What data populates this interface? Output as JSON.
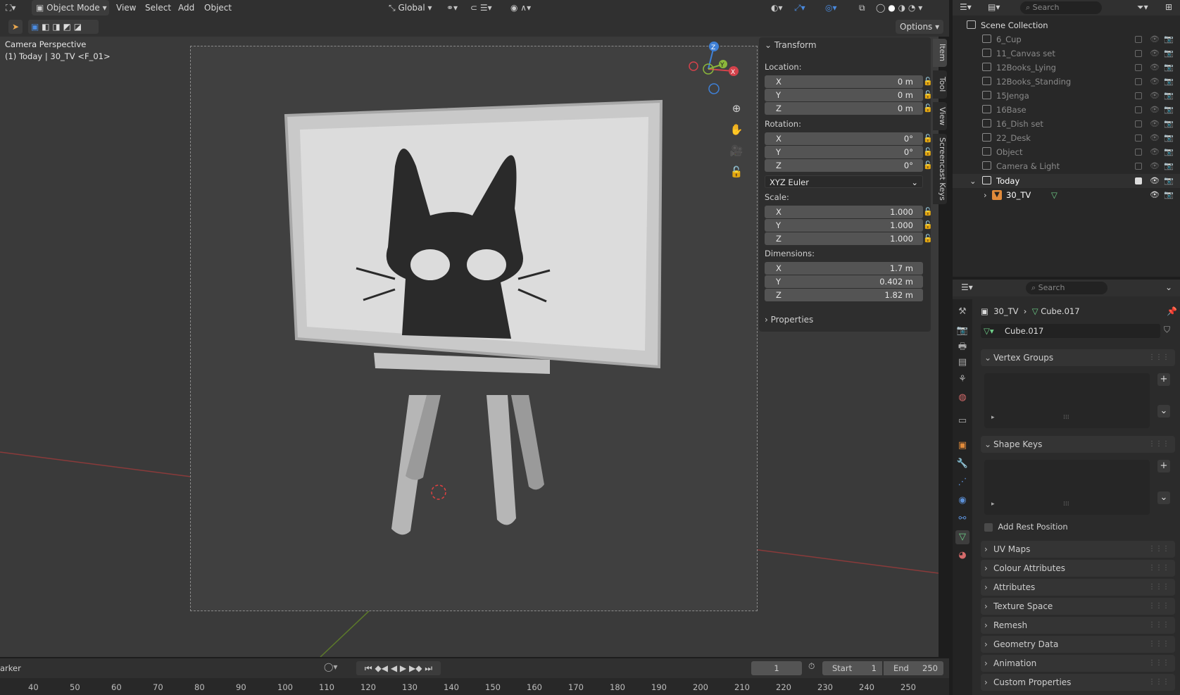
{
  "header": {
    "mode": "Object Mode",
    "menus": [
      "View",
      "Select",
      "Add",
      "Object"
    ],
    "orientation": "Global",
    "options": "Options"
  },
  "viewport": {
    "camera_label": "Camera Perspective",
    "object_label": "(1) Today | 30_TV <F_01>",
    "gizmo": {
      "z": "Z",
      "y": "Y",
      "x": "X"
    }
  },
  "npanel": {
    "transform_title": "Transform",
    "location_label": "Location:",
    "location": [
      {
        "axis": "X",
        "value": "0 m"
      },
      {
        "axis": "Y",
        "value": "0 m"
      },
      {
        "axis": "Z",
        "value": "0 m"
      }
    ],
    "rotation_label": "Rotation:",
    "rotation": [
      {
        "axis": "X",
        "value": "0°"
      },
      {
        "axis": "Y",
        "value": "0°"
      },
      {
        "axis": "Z",
        "value": "0°"
      }
    ],
    "rotation_mode": "XYZ Euler",
    "scale_label": "Scale:",
    "scale": [
      {
        "axis": "X",
        "value": "1.000"
      },
      {
        "axis": "Y",
        "value": "1.000"
      },
      {
        "axis": "Z",
        "value": "1.000"
      }
    ],
    "dimensions_label": "Dimensions:",
    "dimensions": [
      {
        "axis": "X",
        "value": "1.7 m"
      },
      {
        "axis": "Y",
        "value": "0.402 m"
      },
      {
        "axis": "Z",
        "value": "1.82 m"
      }
    ],
    "properties_title": "Properties",
    "tabs": [
      "Item",
      "Tool",
      "View",
      "Screencast Keys"
    ]
  },
  "outliner": {
    "search_placeholder": "Search",
    "root": "Scene Collection",
    "items": [
      "6_Cup",
      "11_Canvas set",
      "12Books_Lying",
      "12Books_Standing",
      "15Jenga",
      "16Base",
      "16_Dish set",
      "22_Desk",
      "Object",
      "Camera & Light"
    ],
    "active_collection": "Today",
    "active_object": "30_TV"
  },
  "properties": {
    "search_placeholder": "Search",
    "breadcrumb_object": "30_TV",
    "breadcrumb_mesh": "Cube.017",
    "mesh_name": "Cube.017",
    "vertex_groups": "Vertex Groups",
    "shape_keys": "Shape Keys",
    "add_rest_position": "Add Rest Position",
    "sections": [
      "UV Maps",
      "Colour Attributes",
      "Attributes",
      "Texture Space",
      "Remesh",
      "Geometry Data",
      "Animation",
      "Custom Properties"
    ]
  },
  "timeline": {
    "marker": "arker",
    "current_frame": "1",
    "start_label": "Start",
    "start": "1",
    "end_label": "End",
    "end": "250",
    "ticks": [
      "40",
      "50",
      "60",
      "70",
      "80",
      "90",
      "100",
      "110",
      "120",
      "130",
      "140",
      "150",
      "160",
      "170",
      "180",
      "190",
      "200",
      "210",
      "220",
      "230",
      "240",
      "250"
    ]
  },
  "colors": {
    "accent": "#4772b3",
    "x_axis": "#d4424b",
    "y_axis": "#8bb73b",
    "z_axis": "#3f80d6",
    "mesh_data": "#6fd18a"
  }
}
